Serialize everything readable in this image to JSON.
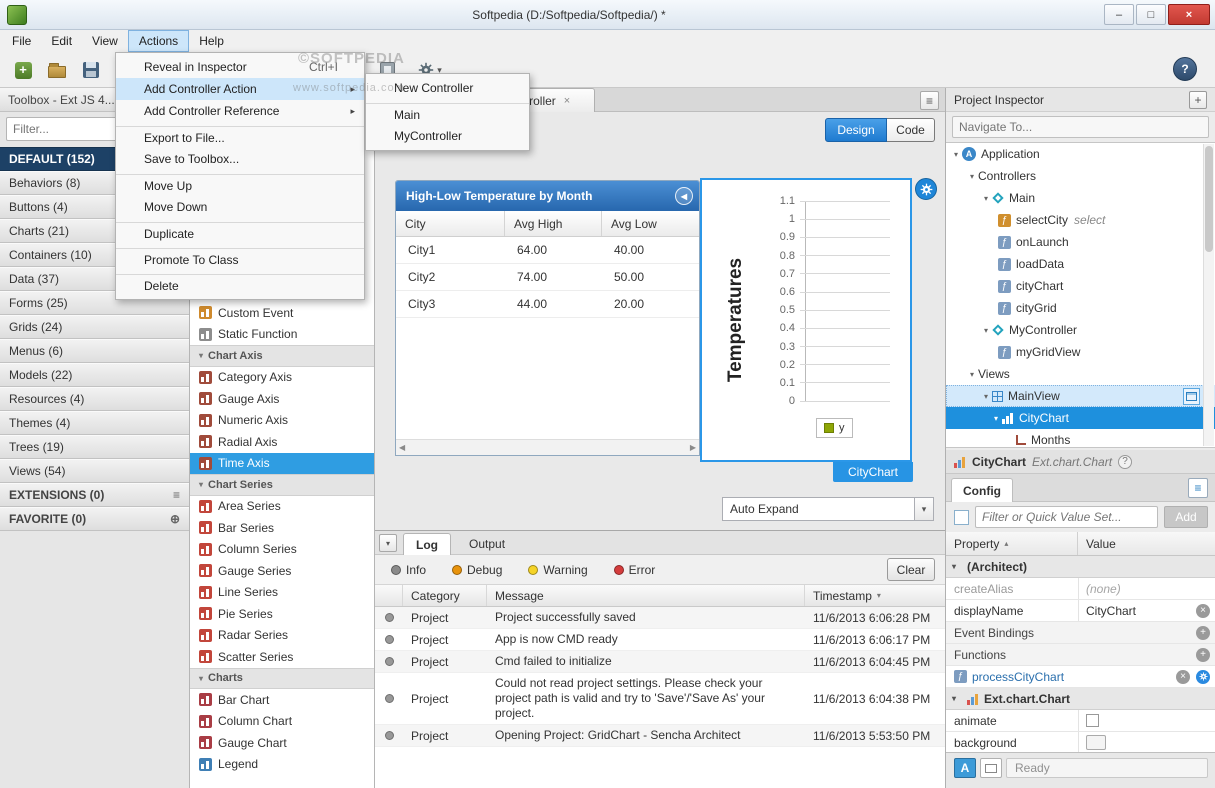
{
  "window": {
    "title": "Softpedia (D:/Softpedia/Softpedia/) *"
  },
  "icons": {
    "minimize": "–",
    "maximize": "□",
    "close_x": "×",
    "collapse_left": "◀",
    "scroll_left": "◀",
    "scroll_right": "▶",
    "caret_down": "▾",
    "burger": "≡",
    "help": "?",
    "plus": "+",
    "sort_asc": "▴",
    "remove": "×",
    "add_circle": "+",
    "tab_close": "×"
  },
  "watermarks": {
    "top": "©SOFTPEDIA",
    "menu": "www.softpedia.com"
  },
  "menubar": {
    "items": [
      {
        "label": "File",
        "cls": ""
      },
      {
        "label": "Edit",
        "cls": ""
      },
      {
        "label": "View",
        "cls": ""
      },
      {
        "label": "Actions",
        "cls": "active"
      },
      {
        "label": "Help",
        "cls": ""
      }
    ]
  },
  "actions_menu": {
    "items": [
      {
        "label": "Reveal in Inspector",
        "shortcut": "Ctrl+I",
        "arrow": "",
        "cls": ""
      },
      {
        "label": "Add Controller Action",
        "shortcut": "",
        "arrow": "▸",
        "cls": "hl"
      },
      {
        "label": "Add Controller Reference",
        "shortcut": "",
        "arrow": "▸",
        "cls": ""
      },
      {
        "label": "Export to File...",
        "shortcut": "",
        "arrow": "",
        "cls": "septop"
      },
      {
        "label": "Save to Toolbox...",
        "shortcut": "",
        "arrow": "",
        "cls": ""
      },
      {
        "label": "Move Up",
        "shortcut": "",
        "arrow": "",
        "cls": "septop"
      },
      {
        "label": "Move Down",
        "shortcut": "",
        "arrow": "",
        "cls": ""
      },
      {
        "label": "Duplicate",
        "shortcut": "",
        "arrow": "",
        "cls": "septop"
      },
      {
        "label": "Promote To Class",
        "shortcut": "",
        "arrow": "",
        "cls": "septop"
      },
      {
        "label": "Delete",
        "shortcut": "",
        "arrow": "",
        "cls": "septop"
      }
    ]
  },
  "controller_submenu": {
    "items": [
      {
        "label": "New Controller",
        "cls": ""
      },
      {
        "label": "Main",
        "cls": "septop"
      },
      {
        "label": "MyController",
        "cls": ""
      }
    ]
  },
  "toolbox": {
    "header": "Toolbox - Ext JS 4...",
    "filter_placeholder": "Filter...",
    "categories": [
      {
        "label": "DEFAULT (152)",
        "cls": "sel",
        "ric": ""
      },
      {
        "label": "Behaviors (8)",
        "cls": "",
        "ric": ""
      },
      {
        "label": "Buttons (4)",
        "cls": "",
        "ric": ""
      },
      {
        "label": "Charts (21)",
        "cls": "",
        "ric": ""
      },
      {
        "label": "Containers (10)",
        "cls": "",
        "ric": ""
      },
      {
        "label": "Data (37)",
        "cls": "",
        "ric": ""
      },
      {
        "label": "Forms (25)",
        "cls": "",
        "ric": ""
      },
      {
        "label": "Grids (24)",
        "cls": "",
        "ric": ""
      },
      {
        "label": "Menus (6)",
        "cls": "",
        "ric": ""
      },
      {
        "label": "Models (22)",
        "cls": "",
        "ric": ""
      },
      {
        "label": "Resources (4)",
        "cls": "",
        "ric": ""
      },
      {
        "label": "Themes (4)",
        "cls": "",
        "ric": ""
      },
      {
        "label": "Trees (19)",
        "cls": "",
        "ric": ""
      },
      {
        "label": "Views (54)",
        "cls": "",
        "ric": ""
      },
      {
        "label": "EXTENSIONS (0)",
        "cls": "hdr2",
        "ric": "≡"
      },
      {
        "label": "FAVORITE (0)",
        "cls": "hdr2",
        "ric": "⊕"
      }
    ],
    "items": [
      {
        "label": "Custom Event",
        "cls": "item",
        "ic": "tic tic-ev"
      },
      {
        "label": "Static Function",
        "cls": "item",
        "ic": "tic tic-fn"
      },
      {
        "label": "Chart Axis",
        "cls": "hdr",
        "ic": "tic-none"
      },
      {
        "label": "Category Axis",
        "cls": "item",
        "ic": "tic tic-axis"
      },
      {
        "label": "Gauge Axis",
        "cls": "item",
        "ic": "tic tic-axis"
      },
      {
        "label": "Numeric Axis",
        "cls": "item",
        "ic": "tic tic-axis"
      },
      {
        "label": "Radial Axis",
        "cls": "item",
        "ic": "tic tic-axis"
      },
      {
        "label": "Time Axis",
        "cls": "item sel",
        "ic": "tic tic-axis"
      },
      {
        "label": "Chart Series",
        "cls": "hdr",
        "ic": "tic-none"
      },
      {
        "label": "Area Series",
        "cls": "item",
        "ic": "tic tic-series"
      },
      {
        "label": "Bar Series",
        "cls": "item",
        "ic": "tic tic-series"
      },
      {
        "label": "Column Series",
        "cls": "item",
        "ic": "tic tic-series"
      },
      {
        "label": "Gauge Series",
        "cls": "item",
        "ic": "tic tic-series"
      },
      {
        "label": "Line Series",
        "cls": "item",
        "ic": "tic tic-series"
      },
      {
        "label": "Pie Series",
        "cls": "item",
        "ic": "tic tic-series"
      },
      {
        "label": "Radar Series",
        "cls": "item",
        "ic": "tic tic-series"
      },
      {
        "label": "Scatter Series",
        "cls": "item",
        "ic": "tic tic-series"
      },
      {
        "label": "Charts",
        "cls": "hdr",
        "ic": "tic-none"
      },
      {
        "label": "Bar Chart",
        "cls": "item",
        "ic": "tic tic-chart"
      },
      {
        "label": "Column Chart",
        "cls": "item",
        "ic": "tic tic-chart"
      },
      {
        "label": "Gauge Chart",
        "cls": "item",
        "ic": "tic tic-chart"
      },
      {
        "label": "Legend",
        "cls": "item",
        "ic": "tic tic-legend"
      }
    ]
  },
  "canvas": {
    "tab": {
      "label": "MyController"
    },
    "design_btn": "Design",
    "code_btn": "Code",
    "auto_expand": "Auto Expand",
    "chart_tag": "CityChart",
    "grid": {
      "title": "High-Low Temperature by Month",
      "columns": [
        "City",
        "Avg High",
        "Avg Low"
      ],
      "rows": [
        {
          "city": "City1",
          "high": "64.00",
          "low": "40.00"
        },
        {
          "city": "City2",
          "high": "74.00",
          "low": "50.00"
        },
        {
          "city": "City3",
          "high": "44.00",
          "low": "20.00"
        }
      ]
    },
    "chart": {
      "ylabel": "Temperatures",
      "ticks": [
        "1.1",
        "1",
        "0.9",
        "0.8",
        "0.7",
        "0.6",
        "0.5",
        "0.4",
        "0.3",
        "0.2",
        "0.1",
        "0"
      ],
      "legend": "y"
    }
  },
  "log": {
    "tabs": [
      "Log",
      "Output"
    ],
    "filters": [
      {
        "label": "Info",
        "dot": "dot-info"
      },
      {
        "label": "Debug",
        "dot": "dot-debug"
      },
      {
        "label": "Warning",
        "dot": "dot-warn"
      },
      {
        "label": "Error",
        "dot": "dot-error"
      }
    ],
    "clear": "Clear",
    "columns": [
      "Category",
      "Message",
      "Timestamp"
    ],
    "rows": [
      {
        "category": "Project",
        "message": "Project successfully saved",
        "time": "11/6/2013 6:06:28 PM"
      },
      {
        "category": "Project",
        "message": "App is now CMD ready",
        "time": "11/6/2013 6:06:17 PM"
      },
      {
        "category": "Project",
        "message": "Cmd failed to initialize",
        "time": "11/6/2013 6:04:45 PM"
      },
      {
        "category": "Project",
        "message": "Could not read project settings. Please check your project path is valid and try to 'Save'/'Save As' your project.",
        "time": "11/6/2013 6:04:38 PM"
      },
      {
        "category": "Project",
        "message": "Opening Project: GridChart - Sencha Architect",
        "time": "11/6/2013 5:53:50 PM"
      }
    ]
  },
  "inspector": {
    "title": "Project Inspector",
    "navigate_placeholder": "Navigate To...",
    "tree": [
      {
        "arrow": "▾",
        "icon": "ic-app",
        "label": "Application",
        "suffix": "",
        "cls": "ind0"
      },
      {
        "arrow": "▾",
        "icon": "ic-none",
        "label": "Controllers",
        "suffix": "",
        "cls": "ind1"
      },
      {
        "arrow": "▾",
        "icon": "ic-ctrl",
        "label": "Main",
        "suffix": "",
        "cls": "ind2"
      },
      {
        "arrow": "",
        "icon": "ic-ev",
        "label": "selectCity",
        "suffix": "select",
        "cls": "ind3"
      },
      {
        "arrow": "",
        "icon": "ic-fn",
        "label": "onLaunch",
        "suffix": "",
        "cls": "ind3"
      },
      {
        "arrow": "",
        "icon": "ic-fn",
        "label": "loadData",
        "suffix": "",
        "cls": "ind3"
      },
      {
        "arrow": "",
        "icon": "ic-fn",
        "label": "cityChart",
        "suffix": "",
        "cls": "ind3"
      },
      {
        "arrow": "",
        "icon": "ic-fn",
        "label": "cityGrid",
        "suffix": "",
        "cls": "ind3"
      },
      {
        "arrow": "▾",
        "icon": "ic-ctrl",
        "label": "MyController",
        "suffix": "",
        "cls": "ind2"
      },
      {
        "arrow": "",
        "icon": "ic-fn",
        "label": "myGridView",
        "suffix": "",
        "cls": "ind3"
      },
      {
        "arrow": "▾",
        "icon": "ic-none",
        "label": "Views",
        "suffix": "",
        "cls": "ind1"
      },
      {
        "arrow": "▾",
        "icon": "ic-grid",
        "label": "MainView",
        "suffix": "",
        "cls": "ind2 hl"
      },
      {
        "arrow": "▾",
        "icon": "ic-chart",
        "label": "CityChart",
        "suffix": "",
        "cls": "ind4 sel"
      },
      {
        "arrow": "",
        "icon": "ic-axis2",
        "label": "Months",
        "suffix": "",
        "cls": "ind5"
      }
    ],
    "component": {
      "name": "CityChart",
      "type": "Ext.chart.Chart"
    },
    "config_tab": "Config",
    "filter_placeholder": "Filter or Quick Value Set...",
    "add_btn": "Add",
    "grid": {
      "property_col": "Property",
      "value_col": "Value"
    },
    "props": [
      {
        "name": "(Architect)"
      },
      {
        "name": "createAlias",
        "value": "(none)"
      },
      {
        "name": "displayName",
        "value": "CityChart"
      },
      {
        "name": "Event Bindings"
      },
      {
        "name": "Functions"
      },
      {
        "name": "processCityChart"
      },
      {
        "name": "Ext.chart.Chart"
      },
      {
        "name": "animate"
      },
      {
        "name": "background"
      }
    ],
    "status": "Ready"
  }
}
